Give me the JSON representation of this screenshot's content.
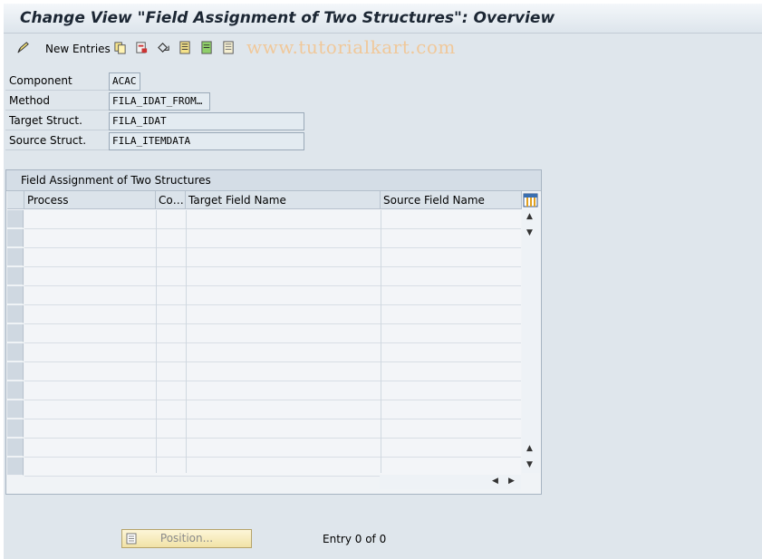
{
  "window": {
    "title": "Change View \"Field Assignment of Two Structures\": Overview"
  },
  "toolbar": {
    "new_entries_label": "New Entries",
    "icons": [
      "edit-pencil-icon",
      "copy-icon",
      "delete-icon",
      "undo-icon",
      "select-all-icon",
      "select-block-icon",
      "deselect-all-icon"
    ]
  },
  "watermark": "www.tutorialkart.com",
  "fields": [
    {
      "label": "Component",
      "value": "ACAC"
    },
    {
      "label": "Method",
      "value": "FILA_IDAT_FROM…"
    },
    {
      "label": "Target Struct.",
      "value": "FILA_IDAT"
    },
    {
      "label": "Source Struct.",
      "value": "FILA_ITEMDATA"
    }
  ],
  "table": {
    "title": "Field Assignment of Two Structures",
    "columns": [
      "Process",
      "Co…",
      "Target Field Name",
      "Source Field Name"
    ],
    "rows": []
  },
  "footer": {
    "position_label": "Position...",
    "entry_text": "Entry 0 of 0"
  },
  "colors": {
    "title": "#1c2734",
    "background": "#dfe6ec",
    "watermark": "#f0c89a",
    "position_button": "#f1e2a6"
  }
}
